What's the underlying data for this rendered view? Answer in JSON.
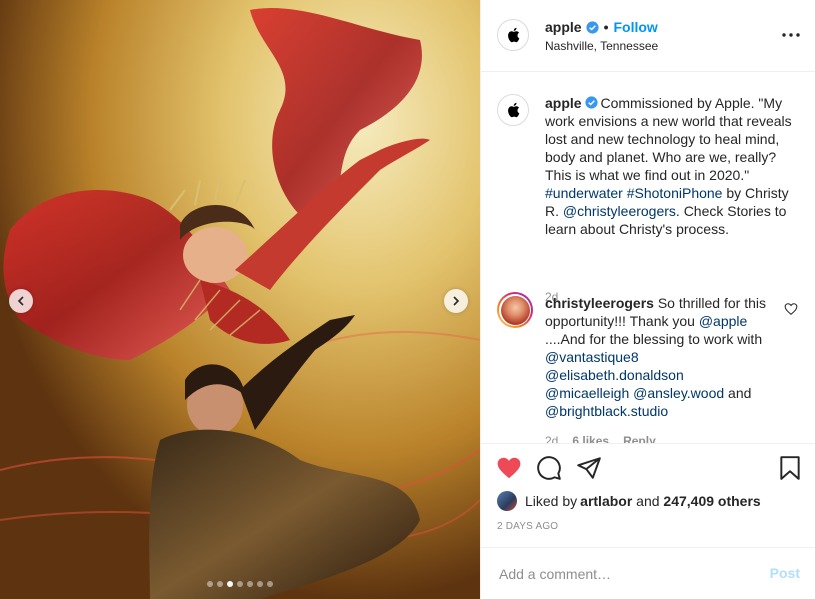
{
  "post": {
    "username": "apple",
    "separator": "•",
    "follow_label": "Follow",
    "location": "Nashville, Tennessee"
  },
  "caption": {
    "username": "apple",
    "text_1": "Commissioned by Apple. \"My work envisions a new world that reveals lost and new technology to heal mind, body and planet. Who are we, really? This is what we find out in 2020.\" ",
    "hashtag_1": "#underwater",
    "space_1": " ",
    "hashtag_2": "#ShotoniPhone",
    "text_2": " by Christy R. ",
    "mention_1": "@christyleerogers",
    "text_3": ". Check Stories to learn about Christy's process.",
    "time": "2d"
  },
  "comment": {
    "username": "christyleerogers",
    "text_1": " So thrilled for this opportunity!!! Thank you ",
    "mention_apple": "@apple",
    "text_2": " ....And for the blessing to work with ",
    "mention_v": "@vantastique8",
    "mention_e": "@elisabeth.donaldson",
    "mention_m": "@micaelleigh",
    "mention_a": "@ansley.wood",
    "text_and": " and ",
    "mention_b": "@brightblack.studio",
    "time": "2d",
    "likes": "6 likes",
    "reply": "Reply"
  },
  "likes": {
    "prefix": "Liked by ",
    "user": "artlabor",
    "middle": " and ",
    "count": "247,409 others"
  },
  "time_ago": "2 DAYS AGO",
  "add_comment": {
    "placeholder": "Add a comment…",
    "post_label": "Post"
  },
  "carousel": {
    "total": 7,
    "active_index": 2
  },
  "colors": {
    "accent": "#0095f6",
    "like": "#ed4956",
    "link": "#00376b",
    "muted": "#8e8e8e"
  },
  "icons": [
    "apple-logo-icon",
    "verified-icon",
    "more-icon",
    "chevron-left-icon",
    "chevron-right-icon",
    "heart-icon",
    "comment-icon",
    "share-icon",
    "bookmark-icon"
  ]
}
